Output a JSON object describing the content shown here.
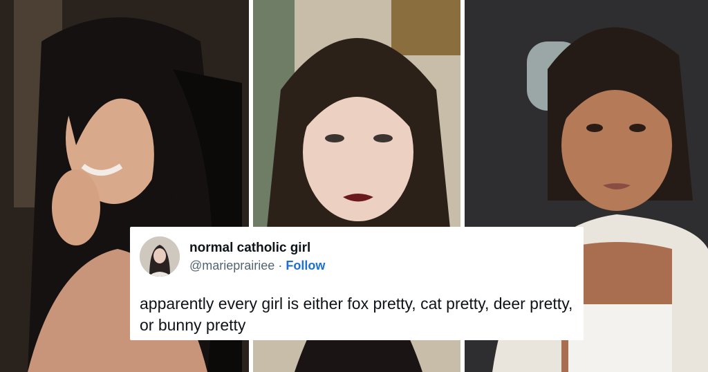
{
  "tweet": {
    "display_name": "normal catholic girl",
    "handle": "@marieprairiee",
    "separator": "·",
    "follow_label": "Follow",
    "text": "apparently every girl is either fox pretty, cat pretty, deer pretty, or bunny pretty"
  },
  "icons": {
    "avatar": "profile-photo"
  },
  "colors": {
    "follow": "#1d6fd3",
    "handle": "#536471",
    "card": "#ffffff"
  }
}
